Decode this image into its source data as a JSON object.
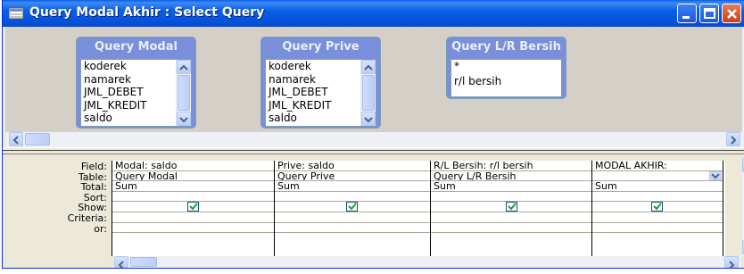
{
  "window": {
    "title": "Query Modal Akhir : Select Query",
    "title_icon": "query-icon",
    "accent_color": "#0a5ee8"
  },
  "field_lists": [
    {
      "title": "Query Modal",
      "items": [
        "koderek",
        "namarek",
        "JML_DEBET",
        "JML_KREDIT",
        "saldo"
      ]
    },
    {
      "title": "Query Prive",
      "items": [
        "koderek",
        "namarek",
        "JML_DEBET",
        "JML_KREDIT",
        "saldo"
      ]
    },
    {
      "title": "Query L/R Bersih",
      "items": [
        "*",
        "r/l bersih"
      ]
    }
  ],
  "grid": {
    "row_labels": [
      "Field:",
      "Table:",
      "Total:",
      "Sort:",
      "Show:",
      "Criteria:",
      "or:"
    ],
    "columns": [
      {
        "field": "Modal: saldo",
        "table": "Query Modal",
        "total": "Sum",
        "sort": "",
        "show": true,
        "criteria": "",
        "or": ""
      },
      {
        "field": "Prive: saldo",
        "table": "Query Prive",
        "total": "Sum",
        "sort": "",
        "show": true,
        "criteria": "",
        "or": ""
      },
      {
        "field": "R/L Bersih: r/l bersih",
        "table": "Query L/R Bersih",
        "total": "Sum",
        "sort": "",
        "show": true,
        "criteria": "",
        "or": ""
      },
      {
        "field": "MODAL AKHIR:",
        "table": "",
        "total": "Sum",
        "sort": "",
        "show": true,
        "criteria": "",
        "or": ""
      }
    ]
  }
}
